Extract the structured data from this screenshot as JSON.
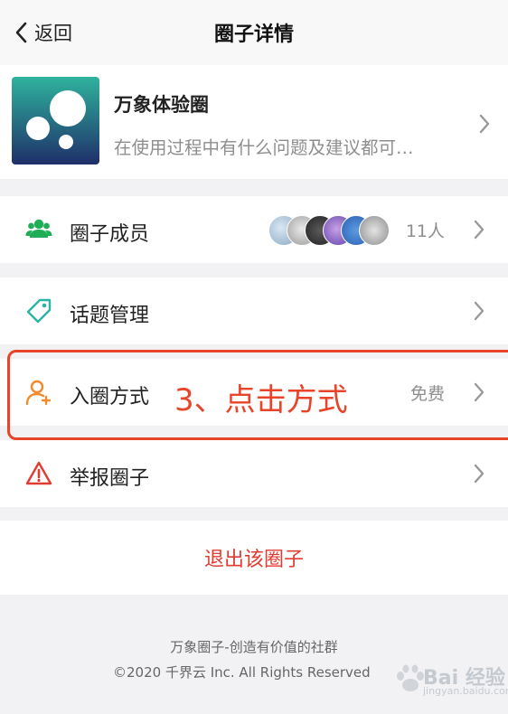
{
  "nav": {
    "back_label": "返回",
    "title": "圈子详情"
  },
  "circle": {
    "name": "万象体验圈",
    "description": "在使用过程中有什么问题及建议都可…",
    "logo_colors": {
      "top": "#2fb39d",
      "bottom": "#1f2f6a"
    }
  },
  "menu": {
    "members": {
      "label": "圈子成员",
      "count": "11人",
      "icon": "users-icon"
    },
    "topics": {
      "label": "话题管理",
      "icon": "tag-icon"
    },
    "join": {
      "label": "入圈方式",
      "value": "免费",
      "icon": "user-add-icon"
    },
    "report": {
      "label": "举报圈子",
      "icon": "warning-icon"
    }
  },
  "annotation": {
    "text": "3、点击方式",
    "color": "#e8442a"
  },
  "logout": {
    "label": "退出该圈子"
  },
  "footer": {
    "line1": "万象圈子-创造有价值的社群",
    "line2": "©2020 千界云 Inc. All Rights Reserved"
  },
  "watermark": {
    "text": "Bai 经验",
    "sub": "jingyan.baidu.com"
  },
  "colors": {
    "accent_green": "#1fae55",
    "danger": "#e03c31",
    "teal": "#2bb4a6",
    "orange": "#f08a2c"
  }
}
